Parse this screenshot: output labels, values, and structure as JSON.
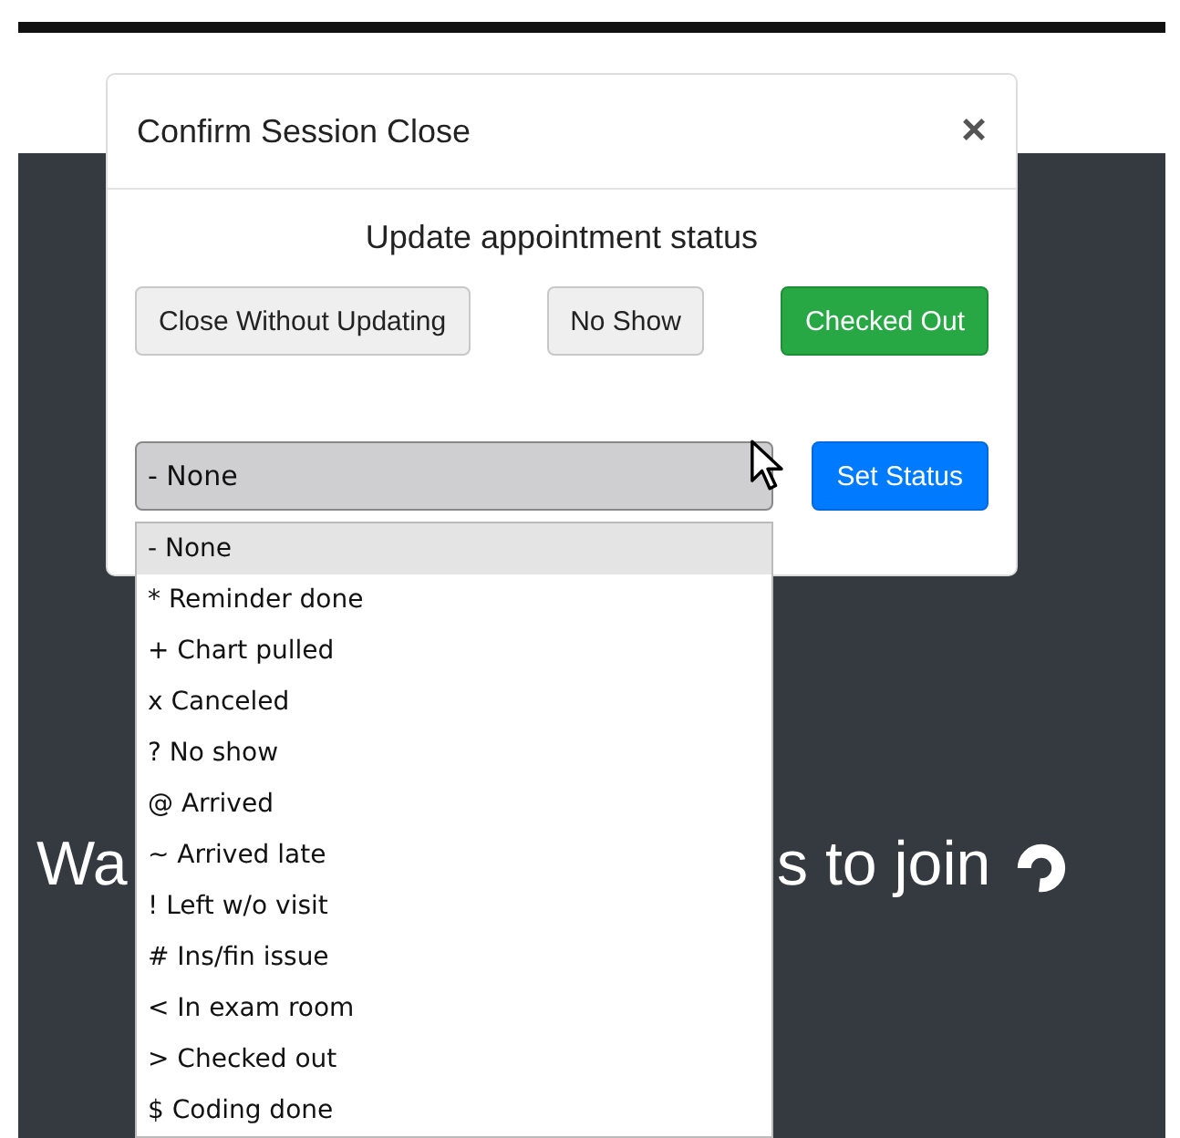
{
  "background": {
    "text_left": "Wa",
    "text_right": "s to join"
  },
  "modal": {
    "title": "Confirm Session Close",
    "close": "×",
    "heading": "Update appointment status",
    "buttons": [
      {
        "label": "Close Without Updating",
        "kind": "secondary"
      },
      {
        "label": "No Show",
        "kind": "secondary"
      },
      {
        "label": "Checked Out",
        "kind": "success"
      }
    ],
    "status_select": {
      "value": "- None",
      "expanded": true
    },
    "set_button": "Set Status"
  },
  "options": [
    {
      "label": "- None",
      "selected": true
    },
    {
      "label": "* Reminder done",
      "selected": false
    },
    {
      "label": "+ Chart pulled",
      "selected": false
    },
    {
      "label": "x Canceled",
      "selected": false
    },
    {
      "label": "? No show",
      "selected": false
    },
    {
      "label": "@ Arrived",
      "selected": false
    },
    {
      "label": "~ Arrived late",
      "selected": false
    },
    {
      "label": "! Left w/o visit",
      "selected": false
    },
    {
      "label": "# Ins/fin issue",
      "selected": false
    },
    {
      "label": "< In exam room",
      "selected": false
    },
    {
      "label": "> Checked out",
      "selected": false
    },
    {
      "label": "$ Coding done",
      "selected": false
    }
  ]
}
